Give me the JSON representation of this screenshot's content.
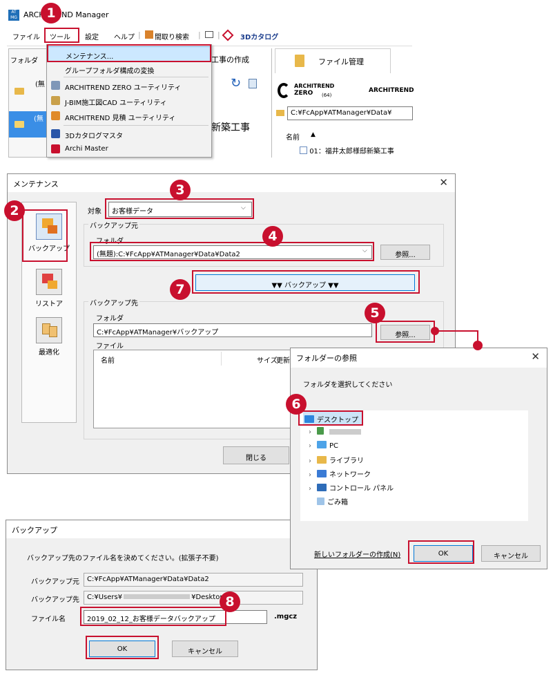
{
  "colors": {
    "accent": "#c8102e",
    "select": "#cce4f7",
    "menu_highlight": "#cce8ff"
  },
  "step_badges": [
    "1",
    "2",
    "3",
    "4",
    "5",
    "6",
    "7",
    "8"
  ],
  "main_window": {
    "app_icon": "AT MG",
    "title": "ARCHITREND Manager",
    "menubar": [
      "ファイル",
      "ツール",
      "設定",
      "ヘルプ",
      "間取り検索",
      "3Dカタログ"
    ],
    "left_tab": "フォルダ",
    "center_tab_suffix": "工事の作成",
    "center_big_text": "新築工事",
    "file_tab": "ファイル管理",
    "archi_logo_top": "ARCHITREND",
    "archi_logo_bottom": "ZERO",
    "archi_logo_bits": "(64)",
    "archi_logo2": "ARCHITREND",
    "path": "C:¥FcApp¥ATManager¥Data¥",
    "list_header": "名前",
    "list_sort": "▲",
    "list_item": "01：福井太郎様邸新築工事",
    "sidebar_marks": [
      "(無",
      "(無"
    ]
  },
  "tools_menu": [
    {
      "label": "メンテナンス...",
      "icon": "maintenance-icon"
    },
    {
      "label": "グループフォルダ構成の変換",
      "icon": "convert-icon"
    },
    {
      "label": "ARCHITREND ZERO ユーティリティ",
      "icon": "zero-utility-icon"
    },
    {
      "label": "J-BIM施工図CAD ユーティリティ",
      "icon": "jbim-icon"
    },
    {
      "label": "ARCHITREND 見積 ユーティリティ",
      "icon": "estimate-icon"
    },
    {
      "label": "3Dカタログマスタ",
      "icon": "catalog-icon"
    },
    {
      "label": "Archi Master",
      "icon": "archi-master-icon"
    }
  ],
  "maintenance": {
    "title": "メンテナンス",
    "sidebar": [
      {
        "label": "バックアップ",
        "icon": "backup-icon"
      },
      {
        "label": "リストア",
        "icon": "restore-icon"
      },
      {
        "label": "最適化",
        "icon": "optimize-icon"
      }
    ],
    "target_label": "対象",
    "target_value": "お客様データ",
    "source_group": "バックアップ元",
    "folder_label": "フォルダ",
    "source_folder": "(無題):C:¥FcApp¥ATManager¥Data¥Data2",
    "browse": "参照...",
    "backup_button": "▼▼ バックアップ ▼▼",
    "dest_group": "バックアップ先",
    "dest_folder": "C:¥FcApp¥ATManager¥バックアップ",
    "file_label": "ファイル",
    "col_name": "名前",
    "col_size": "サイズ",
    "col_updated": "更新",
    "close": "閉じる"
  },
  "folder_browser": {
    "title": "フォルダーの参照",
    "prompt": "フォルダを選択してください",
    "tree": [
      {
        "label": "デスクトップ",
        "icon": "desktop-icon",
        "chev": ""
      },
      {
        "label": "",
        "icon": "user-icon",
        "chev": "›"
      },
      {
        "label": "PC",
        "icon": "pc-icon",
        "chev": "›"
      },
      {
        "label": "ライブラリ",
        "icon": "library-icon",
        "chev": "›"
      },
      {
        "label": "ネットワーク",
        "icon": "network-icon",
        "chev": "›"
      },
      {
        "label": "コントロール パネル",
        "icon": "control-panel-icon",
        "chev": "›"
      },
      {
        "label": "ごみ箱",
        "icon": "recycle-bin-icon",
        "chev": ""
      }
    ],
    "new_folder": "新しいフォルダーの作成(N)",
    "ok": "OK",
    "cancel": "キャンセル"
  },
  "backup_dialog": {
    "title": "バックアップ",
    "instruction": "バックアップ先のファイル名を決めてください。(拡張子不要)",
    "source_label": "バックアップ元",
    "source_value": "C:¥FcApp¥ATManager¥Data¥Data2",
    "dest_label": "バックアップ先",
    "dest_value": "C:¥Users¥",
    "dest_suffix": "¥Desktop",
    "filename_label": "ファイル名",
    "filename_value": "2019_02_12_お客様データバックアップ",
    "extension": ".mgcz",
    "ok": "OK",
    "cancel": "キャンセル"
  }
}
